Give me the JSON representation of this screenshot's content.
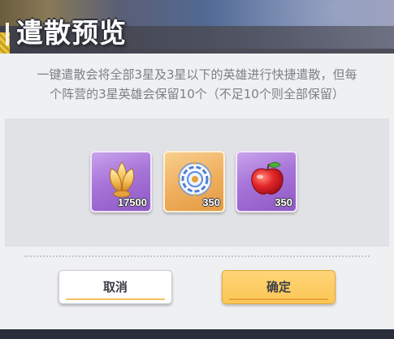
{
  "dialog": {
    "title": "遣散预览",
    "description": "一键遣散会将全部3星及3星以下的英雄进行快捷遣散，但每个阵营的3星英雄会保留10个（不足10个则全部保留）",
    "items": [
      {
        "icon": "golden-tulip-icon",
        "count": "17500",
        "rarity_color": "#a774d8"
      },
      {
        "icon": "rune-disc-icon",
        "count": "350",
        "rarity_color": "#f0b060"
      },
      {
        "icon": "red-apple-icon",
        "count": "350",
        "rarity_color": "#a774d8"
      }
    ],
    "buttons": {
      "cancel_label": "取消",
      "confirm_label": "确定"
    },
    "accent_color": "#fbc655"
  }
}
